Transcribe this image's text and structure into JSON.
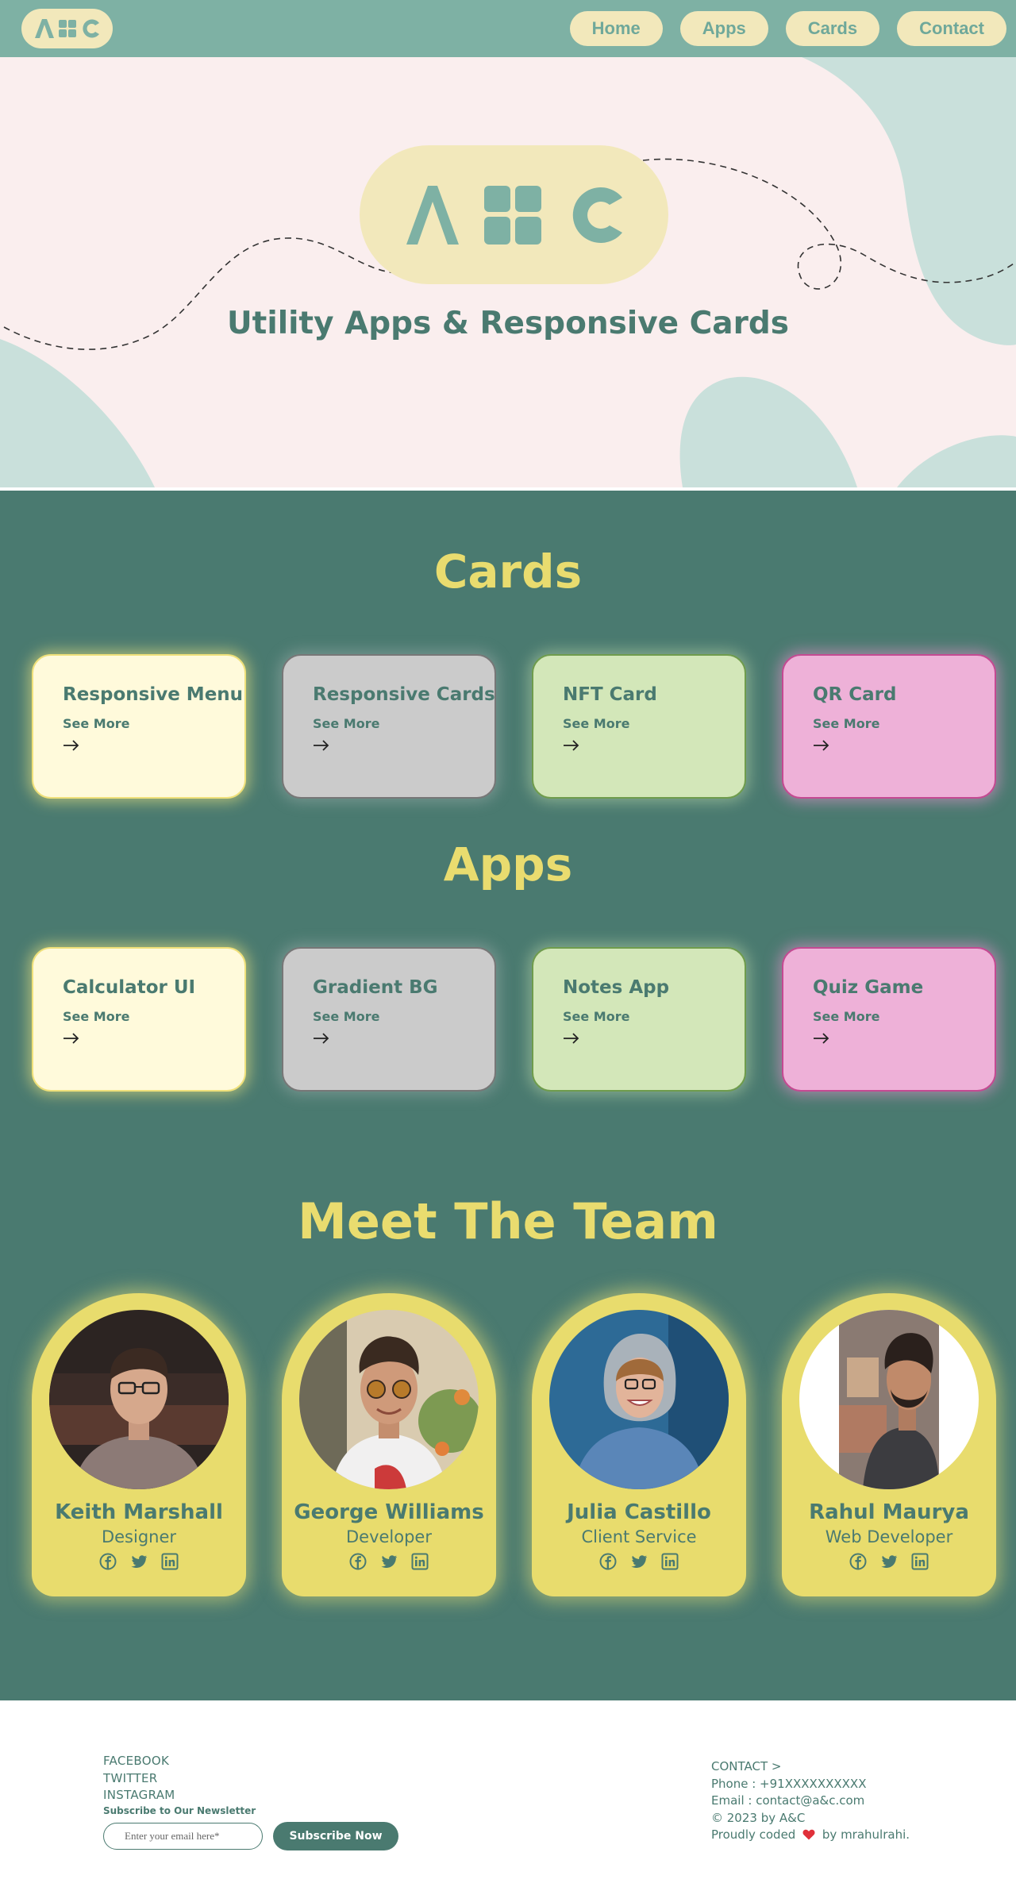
{
  "nav": {
    "logo_icon": "abc-logo-icon",
    "links": [
      {
        "label": "Home"
      },
      {
        "label": "Apps"
      },
      {
        "label": "Cards"
      },
      {
        "label": "Contact"
      }
    ]
  },
  "hero": {
    "title": "Utility Apps & Responsive Cards"
  },
  "cards_section": {
    "heading": "Cards",
    "items": [
      {
        "title": "Responsive Menu",
        "link": "See More",
        "theme": "yellow"
      },
      {
        "title": "Responsive Cards",
        "link": "See More",
        "theme": "gray"
      },
      {
        "title": "NFT Card",
        "link": "See More",
        "theme": "green"
      },
      {
        "title": "QR Card",
        "link": "See More",
        "theme": "pink"
      }
    ]
  },
  "apps_section": {
    "heading": "Apps",
    "items": [
      {
        "title": "Calculator UI",
        "link": "See More",
        "theme": "yellow"
      },
      {
        "title": "Gradient BG",
        "link": "See More",
        "theme": "gray"
      },
      {
        "title": "Notes App",
        "link": "See More",
        "theme": "green"
      },
      {
        "title": "Quiz Game",
        "link": "See More",
        "theme": "pink"
      }
    ]
  },
  "team": {
    "heading": "Meet The Team",
    "members": [
      {
        "name": "Keith Marshall",
        "role": "Designer"
      },
      {
        "name": "George Williams",
        "role": "Developer"
      },
      {
        "name": "Julia Castillo",
        "role": "Client Service"
      },
      {
        "name": "Rahul Maurya",
        "role": "Web Developer"
      }
    ],
    "social_icons": [
      "facebook-icon",
      "twitter-icon",
      "linkedin-icon"
    ]
  },
  "footer": {
    "social_links": [
      "FACEBOOK",
      "TWITTER",
      "INSTAGRAM"
    ],
    "subscribe_label": "Subscribe to Our Newsletter",
    "email_placeholder": "Enter your email here*",
    "subscribe_button": "Subscribe Now",
    "contact_heading": "CONTACT >",
    "phone": "Phone : +91XXXXXXXXXX",
    "email": "Email : contact@a&c.com",
    "copyright": "© 2023 by A&C",
    "credit_prefix": "Proudly coded",
    "credit_suffix": "by mrahulrahi."
  },
  "colors": {
    "nav_bg": "#7eb1a4",
    "pill": "#f2e8bb",
    "primary": "#4a7a70",
    "accent_yellow": "#e9dc6f",
    "hero_bg": "#faeeee",
    "blob": "#c9e0db"
  }
}
